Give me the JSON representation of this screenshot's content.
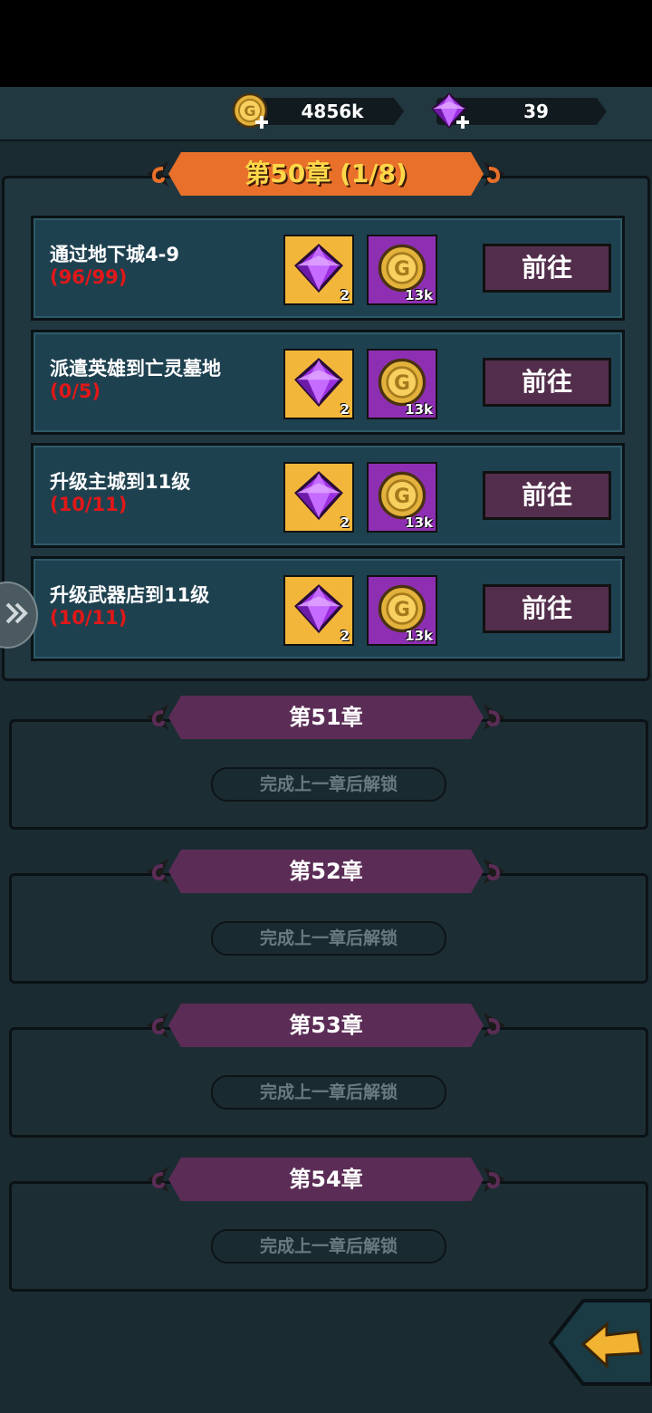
{
  "resources": {
    "gold": {
      "value": "4856k",
      "icon": "gold-coin-icon"
    },
    "gems": {
      "value": "39",
      "icon": "purple-gem-icon"
    }
  },
  "current_chapter": {
    "title": "第50章 (1/8)",
    "tasks": [
      {
        "title": "通过地下城4-9",
        "progress": "(96/99)",
        "gem_reward": "2",
        "gold_reward": "13k",
        "button": "前往"
      },
      {
        "title": "派遣英雄到亡灵墓地",
        "progress": "(0/5)",
        "gem_reward": "2",
        "gold_reward": "13k",
        "button": "前往"
      },
      {
        "title": "升级主城到11级",
        "progress": "(10/11)",
        "gem_reward": "2",
        "gold_reward": "13k",
        "button": "前往"
      },
      {
        "title": "升级武器店到11级",
        "progress": "(10/11)",
        "gem_reward": "2",
        "gold_reward": "13k",
        "button": "前往"
      }
    ]
  },
  "locked_chapters": [
    {
      "title": "第51章",
      "lock_text": "完成上一章后解锁"
    },
    {
      "title": "第52章",
      "lock_text": "完成上一章后解锁"
    },
    {
      "title": "第53章",
      "lock_text": "完成上一章后解锁"
    },
    {
      "title": "第54章",
      "lock_text": "完成上一章后解锁"
    }
  ],
  "colors": {
    "banner_active": "#e8702a",
    "banner_locked": "#5b2d56",
    "progress_red": "#e01818",
    "goto_button": "#532e4c"
  }
}
